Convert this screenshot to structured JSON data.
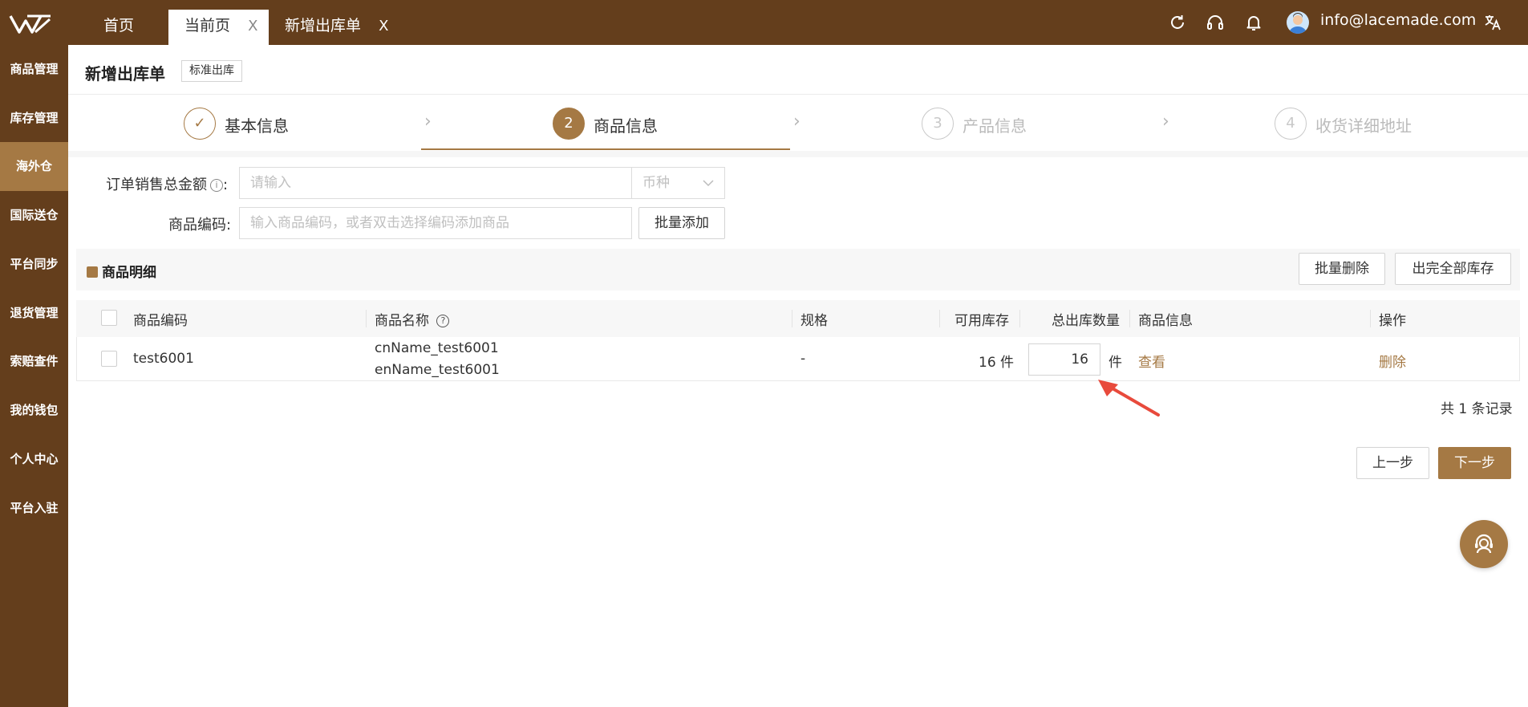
{
  "header": {
    "tabs": [
      {
        "label": "首页",
        "closable": false
      },
      {
        "label": "当前页",
        "closable": true,
        "close": "X"
      },
      {
        "label": "新增出库单",
        "closable": true,
        "close": "X"
      }
    ],
    "user_email": "info@lacemade.com",
    "icons": [
      "refresh-icon",
      "headset-icon",
      "bell-icon",
      "avatar",
      "translate-icon"
    ]
  },
  "sidebar": {
    "items": [
      {
        "label": "商品管理"
      },
      {
        "label": "库存管理"
      },
      {
        "label": "海外仓",
        "active": true
      },
      {
        "label": "国际送仓"
      },
      {
        "label": "平台同步"
      },
      {
        "label": "退货管理"
      },
      {
        "label": "索赔查件"
      },
      {
        "label": "我的钱包"
      },
      {
        "label": "个人中心"
      },
      {
        "label": "平台入驻"
      }
    ]
  },
  "page": {
    "title": "新增出库单",
    "tag": "标准出库"
  },
  "steps": [
    {
      "number": "✓",
      "label": "基本信息",
      "state": "done"
    },
    {
      "number": "2",
      "label": "商品信息",
      "state": "active"
    },
    {
      "number": "3",
      "label": "产品信息",
      "state": "pending"
    },
    {
      "number": "4",
      "label": "收货详细地址",
      "state": "pending"
    }
  ],
  "form": {
    "amount_label": "订单销售总金额",
    "amount_colon": ":",
    "amount_placeholder": "请输入",
    "currency_placeholder": "币种",
    "code_label": "商品编码:",
    "code_placeholder": "输入商品编码，或者双击选择编码添加商品",
    "batch_add": "批量添加"
  },
  "detail": {
    "title": "商品明细",
    "batch_delete": "批量删除",
    "out_all_stock": "出完全部库存"
  },
  "table": {
    "columns": [
      "商品编码",
      "商品名称",
      "规格",
      "可用库存",
      "总出库数量",
      "商品信息",
      "操作"
    ],
    "rows": [
      {
        "code": "test6001",
        "cn_name": "cnName_test6001",
        "en_name": "enName_test6001",
        "spec": "-",
        "available": "16 件",
        "quantity": "16",
        "unit": "件",
        "info_link": "查看",
        "action": "删除"
      }
    ],
    "total": "共 1 条记录"
  },
  "footer": {
    "prev": "上一步",
    "next": "下一步"
  },
  "colors": {
    "brand_dark": "#643e1c",
    "brand": "#a57944",
    "annotation_arrow": "#e84a3c"
  }
}
